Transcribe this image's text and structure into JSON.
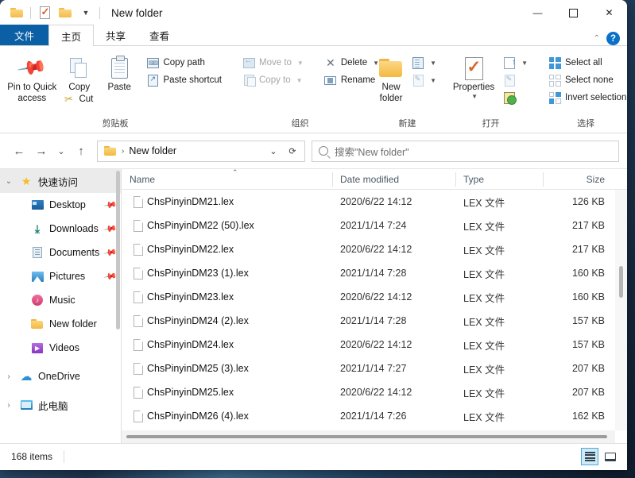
{
  "window": {
    "title": "New folder",
    "controls": {
      "minimize": "—",
      "maximize": "❐",
      "close": "✕"
    },
    "quick_access_toolbar": [
      {
        "name": "folder-properties",
        "icon": "folder-icon"
      },
      {
        "name": "properties",
        "icon": "properties-icon"
      },
      {
        "name": "new-folder",
        "icon": "folder-icon"
      },
      {
        "name": "customize",
        "icon": "chevron-down-icon"
      }
    ]
  },
  "tabs": [
    {
      "id": "file",
      "label": "文件"
    },
    {
      "id": "home",
      "label": "主页"
    },
    {
      "id": "share",
      "label": "共享"
    },
    {
      "id": "view",
      "label": "查看"
    }
  ],
  "tab_right": {
    "collapse": "⌃",
    "help": "?"
  },
  "ribbon": {
    "groups": [
      {
        "label": "剪贴板",
        "big_buttons": [
          {
            "label": "Pin to Quick access",
            "icon": "pin-icon"
          },
          {
            "label": "Copy",
            "icon": "copy-icon"
          },
          {
            "label": "Paste",
            "icon": "paste-icon"
          }
        ],
        "small_buttons": [
          {
            "label": "Copy path",
            "icon": "copy-path-icon",
            "disabled": false
          },
          {
            "label": "Paste shortcut",
            "icon": "paste-shortcut-icon",
            "disabled": false
          },
          {
            "label": "Cut",
            "icon": "scissors-icon",
            "disabled": false
          }
        ]
      },
      {
        "label": "组织",
        "small_buttons": [
          {
            "label": "Move to",
            "icon": "move-to-icon",
            "disabled": true,
            "dropdown": true
          },
          {
            "label": "Copy to",
            "icon": "copy-to-icon",
            "disabled": true,
            "dropdown": true
          },
          {
            "label": "Delete",
            "icon": "delete-icon",
            "disabled": false,
            "dropdown": true
          },
          {
            "label": "Rename",
            "icon": "rename-icon",
            "disabled": false
          }
        ]
      },
      {
        "label": "新建",
        "big_buttons": [
          {
            "label": "New folder",
            "icon": "new-folder-icon"
          }
        ],
        "small_buttons": [
          {
            "label": "",
            "icon": "new-item-icon",
            "dropdown": true
          },
          {
            "label": "",
            "icon": "easy-access-icon",
            "dropdown": true
          }
        ]
      },
      {
        "label": "打开",
        "big_buttons": [
          {
            "label": "Properties",
            "icon": "properties-icon",
            "dropdown": true
          }
        ],
        "small_buttons": [
          {
            "label": "",
            "icon": "open-with-icon",
            "dropdown": true
          },
          {
            "label": "",
            "icon": "edit-icon"
          },
          {
            "label": "",
            "icon": "history-icon"
          }
        ]
      },
      {
        "label": "选择",
        "small_buttons": [
          {
            "label": "Select all",
            "icon": "select-all-icon"
          },
          {
            "label": "Select none",
            "icon": "select-none-icon"
          },
          {
            "label": "Invert selection",
            "icon": "invert-selection-icon"
          }
        ]
      }
    ]
  },
  "addressbar": {
    "back": "←",
    "forward": "→",
    "recent": "⌄",
    "up": "↑",
    "breadcrumb": {
      "folder_icon": "folder-icon",
      "separator": "›",
      "path": "New folder"
    },
    "dropdown": "⌄",
    "refresh": "⟳"
  },
  "search": {
    "placeholder": "搜索\"New folder\"",
    "icon": "search-icon",
    "value": ""
  },
  "sidebar": {
    "items": [
      {
        "label": "快速访问",
        "icon": "star-icon",
        "twisty": "⌄",
        "indent": 0,
        "selected": true,
        "pinned": false
      },
      {
        "label": "Desktop",
        "icon": "desktop-icon",
        "twisty": "",
        "indent": 1,
        "selected": false,
        "pinned": true
      },
      {
        "label": "Downloads",
        "icon": "downloads-icon",
        "twisty": "",
        "indent": 1,
        "selected": false,
        "pinned": true
      },
      {
        "label": "Documents",
        "icon": "documents-icon",
        "twisty": "",
        "indent": 1,
        "selected": false,
        "pinned": true
      },
      {
        "label": "Pictures",
        "icon": "pictures-icon",
        "twisty": "",
        "indent": 1,
        "selected": false,
        "pinned": true
      },
      {
        "label": "Music",
        "icon": "music-icon",
        "twisty": "",
        "indent": 1,
        "selected": false,
        "pinned": false
      },
      {
        "label": "New folder",
        "icon": "folder-icon",
        "twisty": "",
        "indent": 1,
        "selected": false,
        "pinned": false
      },
      {
        "label": "Videos",
        "icon": "videos-icon",
        "twisty": "",
        "indent": 1,
        "selected": false,
        "pinned": false
      },
      {
        "label": "OneDrive",
        "icon": "onedrive-icon",
        "twisty": "›",
        "indent": 0,
        "selected": false,
        "pinned": false
      },
      {
        "label": "此电脑",
        "icon": "this-pc-icon",
        "twisty": "›",
        "indent": 0,
        "selected": false,
        "pinned": false
      }
    ]
  },
  "filelist": {
    "columns": [
      {
        "key": "name",
        "label": "Name",
        "sorted": "asc"
      },
      {
        "key": "date",
        "label": "Date modified",
        "sorted": ""
      },
      {
        "key": "type",
        "label": "Type",
        "sorted": ""
      },
      {
        "key": "size",
        "label": "Size",
        "sorted": ""
      }
    ],
    "sort_caret": "⌃",
    "rows": [
      {
        "name": "ChsPinyinDM21.lex",
        "date": "2020/6/22 14:12",
        "type": "LEX 文件",
        "size": "126 KB"
      },
      {
        "name": "ChsPinyinDM22 (50).lex",
        "date": "2021/1/14 7:24",
        "type": "LEX 文件",
        "size": "217 KB"
      },
      {
        "name": "ChsPinyinDM22.lex",
        "date": "2020/6/22 14:12",
        "type": "LEX 文件",
        "size": "217 KB"
      },
      {
        "name": "ChsPinyinDM23 (1).lex",
        "date": "2021/1/14 7:28",
        "type": "LEX 文件",
        "size": "160 KB"
      },
      {
        "name": "ChsPinyinDM23.lex",
        "date": "2020/6/22 14:12",
        "type": "LEX 文件",
        "size": "160 KB"
      },
      {
        "name": "ChsPinyinDM24 (2).lex",
        "date": "2021/1/14 7:28",
        "type": "LEX 文件",
        "size": "157 KB"
      },
      {
        "name": "ChsPinyinDM24.lex",
        "date": "2020/6/22 14:12",
        "type": "LEX 文件",
        "size": "157 KB"
      },
      {
        "name": "ChsPinyinDM25 (3).lex",
        "date": "2021/1/14 7:27",
        "type": "LEX 文件",
        "size": "207 KB"
      },
      {
        "name": "ChsPinyinDM25.lex",
        "date": "2020/6/22 14:12",
        "type": "LEX 文件",
        "size": "207 KB"
      },
      {
        "name": "ChsPinyinDM26 (4).lex",
        "date": "2021/1/14 7:26",
        "type": "LEX 文件",
        "size": "162 KB"
      }
    ]
  },
  "statusbar": {
    "item_count": "168 items",
    "views": [
      {
        "name": "details-view",
        "icon": "details-view-icon",
        "active": true
      },
      {
        "name": "large-icons-view",
        "icon": "large-icons-view-icon",
        "active": false
      }
    ]
  },
  "colors": {
    "accent": "#0b5fa5",
    "selection": "#cdeaf7",
    "folder": "#f2bb48"
  }
}
